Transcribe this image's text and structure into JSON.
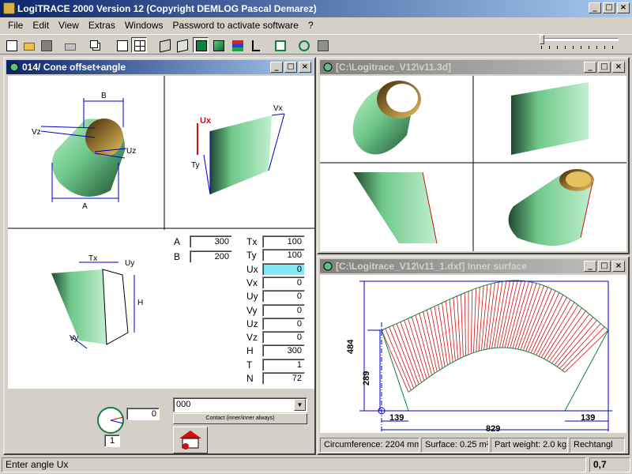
{
  "app": {
    "title": "LogiTRACE 2000  Version 12  (Copyright DEMLOG Pascal Demarez)",
    "window_buttons": [
      "_",
      "□",
      "×"
    ]
  },
  "menu": [
    "File",
    "Edit",
    "View",
    "Extras",
    "Windows",
    "Password to activate software",
    "?"
  ],
  "toolbar_icons": [
    "new-file-icon",
    "open-folder-icon",
    "save-disk-icon",
    "print-icon",
    "copy-icon",
    "single-view-icon",
    "quad-view-icon",
    "wireframe-cube-icon",
    "outline-cube-icon",
    "solid-green-cube-icon",
    "shaded-green-cube-icon",
    "color-layers-icon",
    "tree-icon",
    "frame-icon",
    "curve-icon",
    "unfold-icon"
  ],
  "left_window": {
    "title": "014/ Cone offset+angle",
    "labels": {
      "B": "B",
      "A": "A",
      "Vz": "Vz",
      "Uz": "Uz",
      "Ux": "Ux",
      "Vx": "Vx",
      "Ty": "Ty",
      "Tx": "Tx",
      "Uy": "Uy",
      "H": "H",
      "Vy": "Vy"
    },
    "fields_left": [
      {
        "label": "A",
        "value": "300"
      },
      {
        "label": "B",
        "value": "200"
      }
    ],
    "fields_right": [
      {
        "label": "Tx",
        "value": "100"
      },
      {
        "label": "Ty",
        "value": "100"
      },
      {
        "label": "Ux",
        "value": "0"
      },
      {
        "label": "Vx",
        "value": "0"
      },
      {
        "label": "Uy",
        "value": "0"
      },
      {
        "label": "Vy",
        "value": "0"
      },
      {
        "label": "Uz",
        "value": "0"
      },
      {
        "label": "Vz",
        "value": "0"
      },
      {
        "label": "H",
        "value": "300"
      },
      {
        "label": "T",
        "value": "1"
      },
      {
        "label": "N",
        "value": "72"
      }
    ],
    "angle_value": "0",
    "angle_step": "1",
    "combo_value": "000",
    "contact_label": "Contact (inner/inner always)"
  },
  "view3d_window": {
    "title": "[C:\\Logitrace_V12\\v11.3d]"
  },
  "dxf_window": {
    "title": "[C:\\Logitrace_V12\\v11_1.dxf]  Inner surface",
    "dimensions": {
      "height_total": "484",
      "height_inner": "289",
      "width_total": "829",
      "left_offset": "139",
      "right_offset": "139"
    },
    "status": {
      "circumference": "Circumference: 2204 mm",
      "surface": "Surface: 0.25 m²",
      "weight": "Part weight: 2.0 kg",
      "shape": "Rechtangl"
    }
  },
  "status": {
    "message": "Enter angle Ux",
    "value": "0,7"
  },
  "colors": {
    "title_active": "#0a246a",
    "title_inactive": "#808080",
    "cone_green": "#6fc88a",
    "inner_yellow": "#c8a030",
    "highlight_field": "#80e8f8",
    "dim_blue": "#0000c8",
    "unfold_red": "#d01010"
  }
}
